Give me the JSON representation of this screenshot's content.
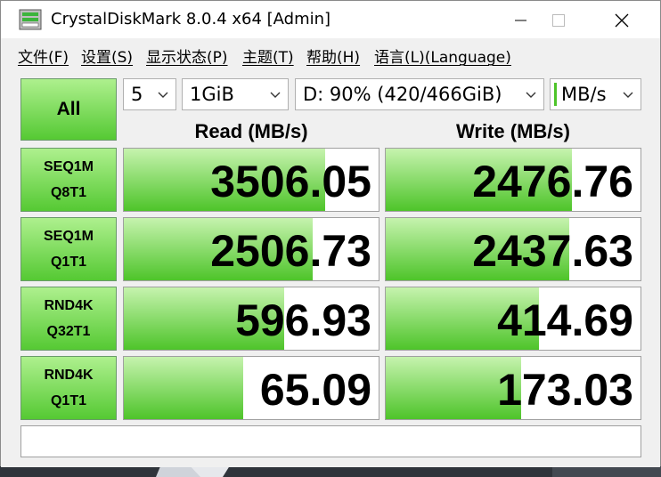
{
  "window": {
    "title": "CrystalDiskMark 8.0.4 x64 [Admin]",
    "icon": "disk-drive-icon"
  },
  "menu": [
    "文件(F)",
    "设置(S)",
    "显示状态(P)",
    "主题(T)",
    "帮助(H)",
    "语言(L)(Language)"
  ],
  "controls": {
    "all_label": "All",
    "count": "5",
    "size": "1GiB",
    "drive": "D: 90% (420/466GiB)",
    "unit": "MB/s"
  },
  "headers": {
    "read": "Read (MB/s)",
    "write": "Write (MB/s)"
  },
  "tests": [
    {
      "line1": "SEQ1M",
      "line2": "Q8T1",
      "read": "3506.05",
      "write": "2476.76",
      "read_fill_pct": 79,
      "write_fill_pct": 73
    },
    {
      "line1": "SEQ1M",
      "line2": "Q1T1",
      "read": "2506.73",
      "write": "2437.63",
      "read_fill_pct": 74,
      "write_fill_pct": 72
    },
    {
      "line1": "RND4K",
      "line2": "Q32T1",
      "read": "596.93",
      "write": "414.69",
      "read_fill_pct": 63,
      "write_fill_pct": 60
    },
    {
      "line1": "RND4K",
      "line2": "Q1T1",
      "read": "65.09",
      "write": "173.03",
      "read_fill_pct": 47,
      "write_fill_pct": 53
    }
  ],
  "comment": "",
  "colors": {
    "accent_green": "#4ec42a",
    "background": "#f0f0f0"
  }
}
